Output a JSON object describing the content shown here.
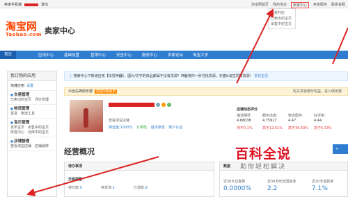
{
  "topbar": {
    "left": [
      "卖家手机端",
      "退出"
    ],
    "right": [
      "淘宝网首页",
      "我的淘宝",
      "卖家中心",
      "卖家服务",
      "联系客服"
    ]
  },
  "dropdown": [
    "免费开店",
    "已卖出的宝贝",
    "出售中的宝贝"
  ],
  "logo": {
    "main": "淘宝网",
    "sub": "Taobao.com"
  },
  "center_title": "卖家中心",
  "nav": [
    "首页",
    "应用中心",
    "基础设置",
    "营销中心",
    "安全中心",
    "服务中心",
    "卖家论坛",
    "淘宝大学"
  ],
  "sidebar": {
    "title": "我订购的应用",
    "quick": "快捷应用",
    "quick_set": "设置",
    "sections": [
      {
        "title": "交易管理",
        "rows": [
          [
            "已卖出的宝贝",
            "评价管理"
          ]
        ]
      },
      {
        "title": "物流管理",
        "rows": [
          [
            "发货",
            "物流工具"
          ]
        ]
      },
      {
        "title": "宝贝管理",
        "rows": [
          [
            "发布宝贝",
            "出售中的宝贝"
          ],
          [
            "体检中心",
            "仓库中的宝贝"
          ]
        ]
      },
      {
        "title": "店铺管理",
        "rows": [
          [
            "查看淘宝店铺",
            "店铺装修"
          ]
        ]
      }
    ]
  },
  "notice": "搜索中心下新增应用【找货神器】，图片/文字的商品都属于没有货源？神器将你一秒寻找货源，天猫&淘宝同款货源！",
  "notice_link": "优化宝贝",
  "club": {
    "text": "众创先锋俱乐部",
    "badge": "您是5级会员",
    "right": "优先享受部分权益，进入俱乐部"
  },
  "shop": {
    "line1": "查看淘宝店铺",
    "meta": [
      "保证金:1000元",
      "订单险",
      "退货承诺",
      "账户认证"
    ]
  },
  "rating": {
    "title": "店铺动态评分",
    "labels": [
      "描述相符:",
      "服务态度:",
      "物流服务:",
      "好评率:"
    ],
    "values": [
      "4.68038",
      "4.75927",
      "4.47",
      "4.44"
    ],
    "compare": [
      "持平0.1%",
      "高于12.61%",
      "高于36.63%",
      "高于5.33%"
    ]
  },
  "overview": "经营概况",
  "todo": {
    "header": "待办事项",
    "sub": "交易提醒",
    "counts": [
      {
        "label": "待付款:",
        "value": "0"
      },
      {
        "label": "待发货:",
        "value": "1"
      },
      {
        "label": "已退款:",
        "value": "9"
      }
    ]
  },
  "stats": {
    "header": "数据",
    "cols": [
      {
        "label": "近30天访客数",
        "value": "0.0000%"
      },
      {
        "label": "近30天旺旺回复率",
        "value": "2.2"
      },
      {
        "label": "近30天退款率",
        "value": "7.1%"
      }
    ]
  },
  "blue_tab": "+",
  "watermark": {
    "main": "百科全说",
    "sub": "助你轻松解决"
  },
  "colors": {
    "nav": "#2f7dd1",
    "brand": "#ff4400",
    "arrow": "#dd2222"
  }
}
